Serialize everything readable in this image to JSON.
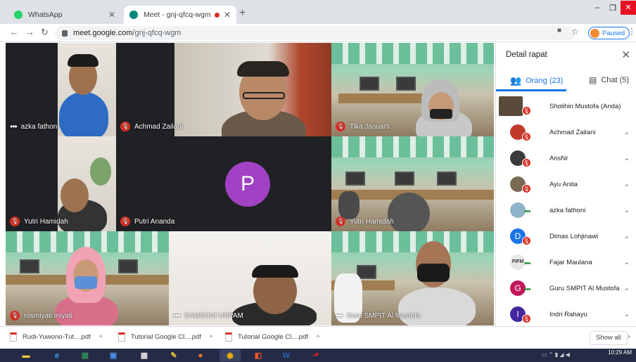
{
  "browser": {
    "tabs": [
      {
        "title": "WhatsApp",
        "active": false,
        "favicon_color": "#25d366"
      },
      {
        "title": "Meet - gnj-qfcq-wgm",
        "active": true,
        "favicon_color": "#00897b"
      }
    ],
    "url_host": "meet.google.com",
    "url_path": "/gnj-qfcq-wgm",
    "profile_label": "Paused"
  },
  "meet": {
    "tiles": [
      {
        "name": "azka fathoni",
        "status": "speaking"
      },
      {
        "name": "Achmad Zailani",
        "status": "muted"
      },
      {
        "name": "Tika Januarti",
        "status": "muted"
      },
      {
        "name": "Yutri Hamidah",
        "status": "muted"
      },
      {
        "name": "Putri Ananda",
        "status": "muted",
        "avatar_letter": "P",
        "avatar_color": "#a142c4"
      },
      {
        "name": "Yutri Hamidah",
        "status": "muted"
      },
      {
        "name": "rosmiyati miyati",
        "status": "muted"
      },
      {
        "name": "SAMSONI UNPAM",
        "status": "speaking"
      },
      {
        "name": "Guru SMPIT Al Mustofa",
        "status": "speaking"
      }
    ],
    "panel": {
      "title": "Detail rapat",
      "people_tab": "Orang (23)",
      "chat_tab": "Chat (5)",
      "participants": [
        {
          "name": "Sholihin Mustofa (Anda)",
          "avatar": "photo",
          "color": "#5a4a3a",
          "status": "muted"
        },
        {
          "name": "Achmad Zailani",
          "avatar": "photo",
          "color": "#c0392b",
          "status": "muted"
        },
        {
          "name": "AnsNr",
          "avatar": "photo",
          "color": "#3b3b3b",
          "status": "muted"
        },
        {
          "name": "Ayu Anita",
          "avatar": "photo",
          "color": "#7a6a55",
          "status": "muted"
        },
        {
          "name": "azka fathoni",
          "avatar": "photo",
          "color": "#8fb3c9",
          "status": "speaking"
        },
        {
          "name": "Dimas Lohjinawi",
          "avatar": "D",
          "color": "#1a73e8",
          "status": "muted"
        },
        {
          "name": "Fajar Maulana",
          "avatar": "FIFM",
          "color": "#e8e8e8",
          "status": "speaking"
        },
        {
          "name": "Guru SMPIT Al Mustofa",
          "avatar": "G",
          "color": "#c2185b",
          "status": "speaking"
        },
        {
          "name": "Indri Rahayu",
          "avatar": "I",
          "color": "#4527a0",
          "status": "muted"
        }
      ]
    }
  },
  "downloads": [
    {
      "name": "Rudi-Yuwono-Tut....pdf"
    },
    {
      "name": "Tutorial Google Cl....pdf"
    },
    {
      "name": "Tutorial Google Cl....pdf"
    }
  ],
  "downloads_show_all": "Show all",
  "taskbar": {
    "time": "10:29 AM"
  }
}
